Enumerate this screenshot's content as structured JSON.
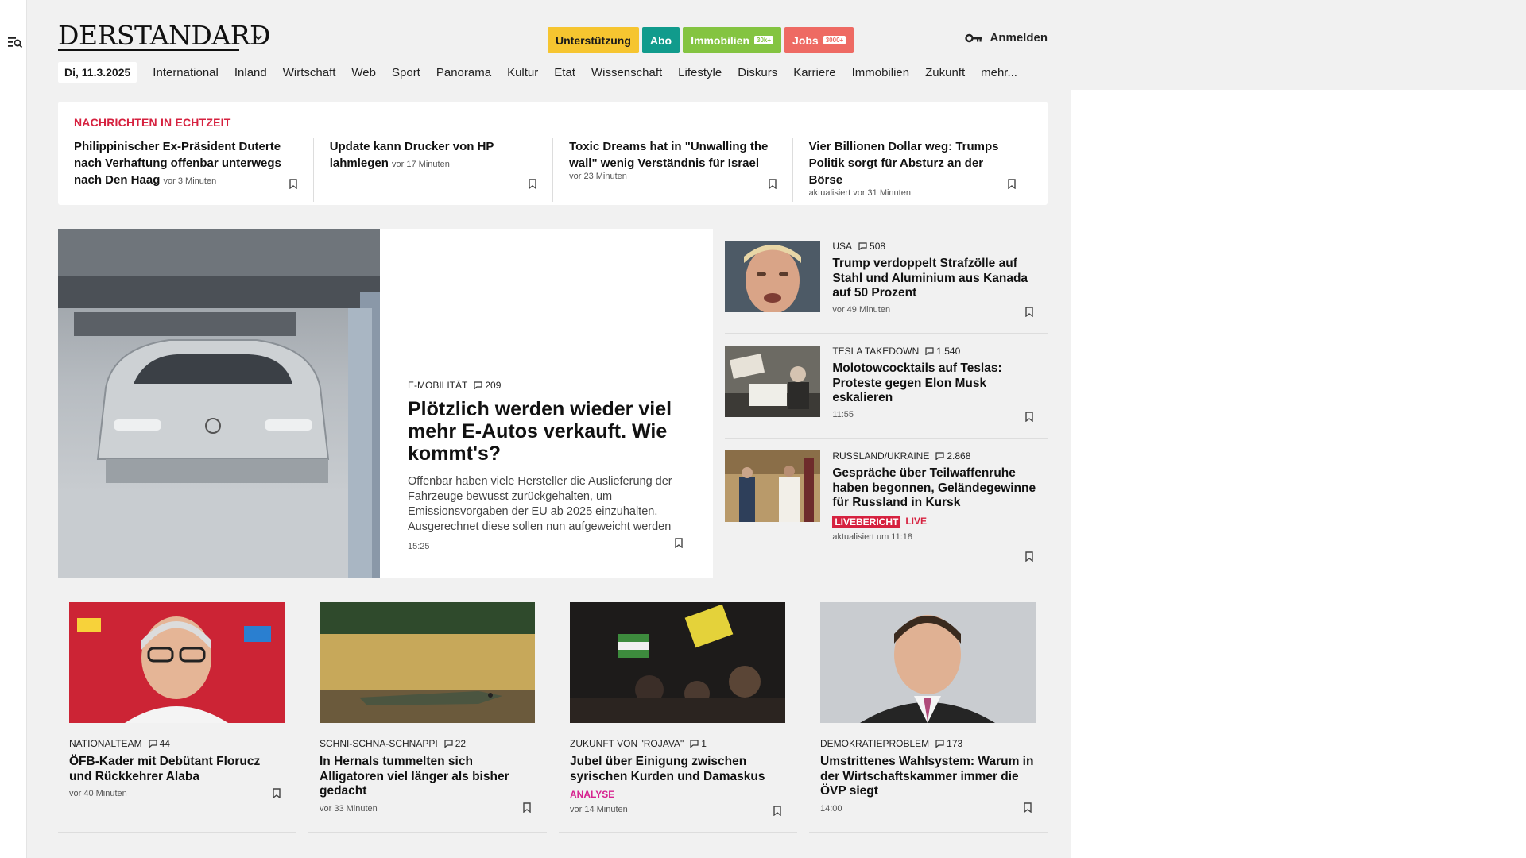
{
  "brand": {
    "logo": "DERSTANDARD"
  },
  "header": {
    "pills": [
      {
        "label": "Unterstützung",
        "tag": "",
        "bg": "#f6c530",
        "fg": "#1a1a1a"
      },
      {
        "label": "Abo",
        "tag": "",
        "bg": "#119b8c",
        "fg": "#ffffff"
      },
      {
        "label": "Immobilien",
        "tag": "30k+",
        "bg": "#84c441",
        "fg": "#ffffff"
      },
      {
        "label": "Jobs",
        "tag": "3000+",
        "bg": "#ee6a63",
        "fg": "#ffffff"
      }
    ],
    "login_label": "Anmelden"
  },
  "nav": {
    "date": "Di, 11.3.2025",
    "items": [
      "International",
      "Inland",
      "Wirtschaft",
      "Web",
      "Sport",
      "Panorama",
      "Kultur",
      "Etat",
      "Wissenschaft",
      "Lifestyle",
      "Diskurs",
      "Karriere",
      "Immobilien",
      "Zukunft",
      "mehr..."
    ]
  },
  "ticker": {
    "title": "NACHRICHTEN IN ECHTZEIT",
    "items": [
      {
        "headline": "Philippinischer Ex-Präsident Duterte nach Verhaftung offenbar unterwegs nach Den Haag",
        "time": "vor 3 Minuten"
      },
      {
        "headline": "Update kann Drucker von HP lahmlegen",
        "time": "vor 17 Minuten"
      },
      {
        "headline": "Toxic Dreams hat in \"Unwalling the wall\" wenig Verständnis für Israel",
        "time": "vor 23 Minuten"
      },
      {
        "headline": "Vier Billionen Dollar weg: Trumps Politik sorgt für Absturz an der Börse",
        "time": "aktualisiert vor 31 Minuten"
      }
    ]
  },
  "hero": {
    "kicker": "E-MOBILITÄT",
    "comments": "209",
    "title": "Plötzlich werden wieder viel mehr E-Autos verkauft. Wie kommt's?",
    "lead": "Offenbar haben viele Hersteller die Auslieferung der Fahrzeuge bewusst zurückgehalten, um Emissionsvorgaben der EU ab 2025 einzuhalten. Ausgerechnet diese sollen nun aufgeweicht werden",
    "time": "15:25"
  },
  "side": [
    {
      "kicker": "USA",
      "comments": "508",
      "title": "Trump verdoppelt Strafzölle auf Stahl und Aluminium aus Kanada auf 50 Prozent",
      "time": "vor 49 Minuten"
    },
    {
      "kicker": "TESLA TAKEDOWN",
      "comments": "1.540",
      "title": "Molotowcocktails auf Teslas: Proteste gegen Elon Musk eskalieren",
      "time": "11:55"
    },
    {
      "kicker": "RUSSLAND/UKRAINE",
      "comments": "2.868",
      "title": "Gespräche über Teilwaffenruhe haben begonnen, Geländegewinne für Russland in Kursk",
      "badge_label": "LIVEBERICHT",
      "badge_live": "LIVE",
      "time": "aktualisiert um 11:18"
    }
  ],
  "cards": [
    {
      "kicker": "NATIONALTEAM",
      "comments": "44",
      "title": "ÖFB-Kader mit Debütant Florucz und Rückkehrer Alaba",
      "time": "vor 40 Minuten"
    },
    {
      "kicker": "SCHNI-SCHNA-SCHNAPPI",
      "comments": "22",
      "title": "In Hernals tummelten sich Alligatoren viel länger als bisher gedacht",
      "time": "vor 33 Minuten"
    },
    {
      "kicker": "ZUKUNFT VON \"ROJAVA\"",
      "comments": "1",
      "title": "Jubel über Einigung zwischen syrischen Kurden und Damaskus",
      "label": "ANALYSE",
      "time": "vor 14 Minuten"
    },
    {
      "kicker": "DEMOKRATIEPROBLEM",
      "comments": "173",
      "title": "Umstrittenes Wahlsystem: Warum in der Wirtschaftskammer immer die ÖVP siegt",
      "time": "14:00"
    }
  ],
  "icons": {
    "menu_search": "menu-search-icon",
    "chevron": "chevron-down-icon",
    "key": "key-icon",
    "comment": "comment-icon",
    "bookmark": "bookmark-icon"
  }
}
